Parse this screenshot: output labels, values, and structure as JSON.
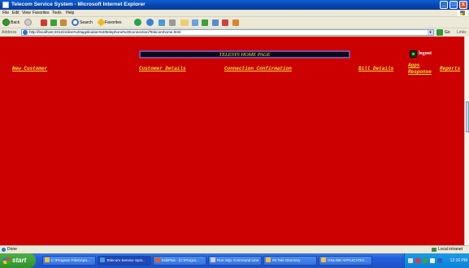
{
  "window": {
    "title": "Telecom Service System - Microsoft Internet Explorer",
    "minimize": "_",
    "maximize": "□",
    "close": "x"
  },
  "menu": [
    "File",
    "Edit",
    "View",
    "Favorites",
    "Tools",
    "Help"
  ],
  "toolbar": {
    "back": "Back",
    "search": "Search",
    "favorites": "Favorites"
  },
  "address": {
    "label": "Address",
    "url": "http://localhost:2012/online%20application%20telephone%20connection/Telecomhome.html",
    "go": "Go",
    "links": "Links"
  },
  "page": {
    "banner": "TELESYS HOME PAGE",
    "logout": "logout",
    "nav": {
      "new_customer": "New Customer",
      "customer_details": "Customer Details",
      "connection_confirmation": "Connection Confirmation",
      "bill_details": "Bill Details",
      "apps_line1": "Apps",
      "apps_line2": "Response",
      "reports": "Reports"
    }
  },
  "status": {
    "text": "Done",
    "zone": "Local intranet"
  },
  "taskbar": {
    "start": "start",
    "items": [
      "C:\\Program Files\\Apa...",
      "Telecom Service Syst...",
      "EditPlus - [C:\\Progra...",
      "Run SQL Command Line",
      "#5 Tele Directory",
      "ONLINE APPLICATIO..."
    ],
    "clock": "12:16 PM"
  },
  "colors": {
    "content_bg": "#cc0000",
    "link": "#f0e040",
    "banner_bg": "#0a0a18",
    "banner_border": "#7a4fa0"
  }
}
